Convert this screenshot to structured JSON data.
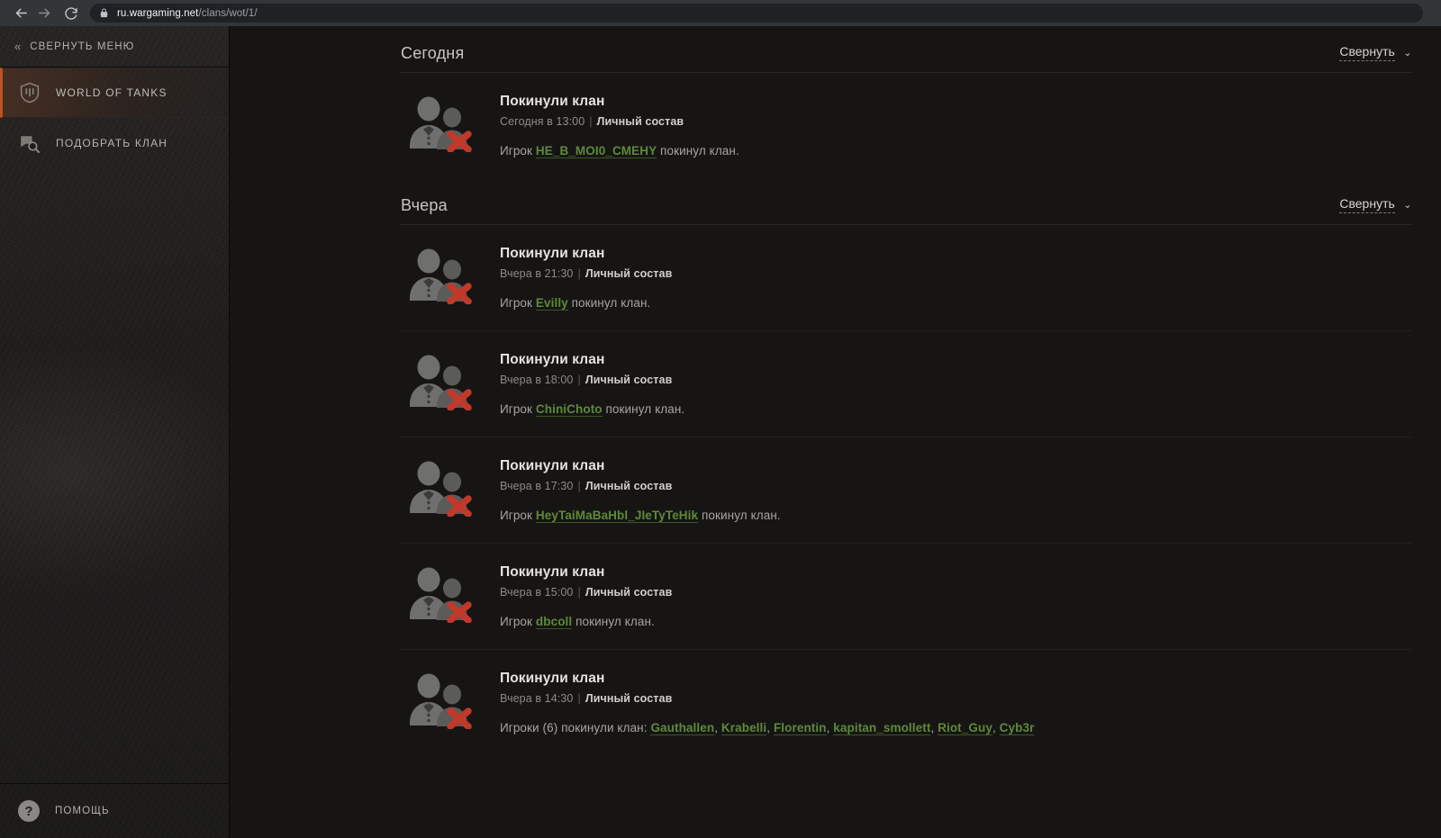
{
  "browser": {
    "back_icon": "back-arrow-icon",
    "forward_icon": "forward-arrow-icon",
    "reload_icon": "reload-icon",
    "lock_icon": "lock-icon",
    "url_host": "ru.wargaming.net",
    "url_path": "/clans/wot/1/"
  },
  "sidebar": {
    "collapse_label": "СВЕРНУТЬ МЕНЮ",
    "collapse_chevrons": "«",
    "items": [
      {
        "label": "WORLD OF TANKS",
        "icon": "wot-shield-icon",
        "active": true
      },
      {
        "label": "ПОДОБРАТЬ КЛАН",
        "icon": "clan-search-icon",
        "active": false
      }
    ],
    "footer": {
      "label": "ПОМОЩЬ",
      "icon": "help-question-icon",
      "glyph": "?"
    }
  },
  "colors": {
    "accent_orange": "#c2521c",
    "player_green": "#5e8a38",
    "red_cross": "#c0392b",
    "page_bg": "#161514",
    "sidebar_bg": "#1e1c1b"
  },
  "sections": [
    {
      "title": "Сегодня",
      "collapse_label": "Свернуть",
      "collapse_chevron": "⌄",
      "events": [
        {
          "icon": "clan-leave-icon",
          "title": "Покинули клан",
          "time": "Сегодня в 13:00",
          "separator": "|",
          "category": "Личный состав",
          "text_before": "Игрок ",
          "players": [
            "HE_B_MOI0_CMEHY"
          ],
          "text_after": " покинул клан."
        }
      ]
    },
    {
      "title": "Вчера",
      "collapse_label": "Свернуть",
      "collapse_chevron": "⌄",
      "events": [
        {
          "icon": "clan-leave-icon",
          "title": "Покинули клан",
          "time": "Вчера в 21:30",
          "separator": "|",
          "category": "Личный состав",
          "text_before": "Игрок ",
          "players": [
            "Evilly"
          ],
          "text_after": " покинул клан."
        },
        {
          "icon": "clan-leave-icon",
          "title": "Покинули клан",
          "time": "Вчера в 18:00",
          "separator": "|",
          "category": "Личный состав",
          "text_before": "Игрок ",
          "players": [
            "ChiniChoto"
          ],
          "text_after": " покинул клан."
        },
        {
          "icon": "clan-leave-icon",
          "title": "Покинули клан",
          "time": "Вчера в 17:30",
          "separator": "|",
          "category": "Личный состав",
          "text_before": "Игрок ",
          "players": [
            "HeyTaiMaBaHbl_JIeTyTeHik"
          ],
          "text_after": " покинул клан."
        },
        {
          "icon": "clan-leave-icon",
          "title": "Покинули клан",
          "time": "Вчера в 15:00",
          "separator": "|",
          "category": "Личный состав",
          "text_before": "Игрок ",
          "players": [
            "dbcoll"
          ],
          "text_after": " покинул клан."
        },
        {
          "icon": "clan-leave-icon",
          "title": "Покинули клан",
          "time": "Вчера в 14:30",
          "separator": "|",
          "category": "Личный состав",
          "text_before": "Игроки (6) покинули клан: ",
          "players": [
            "Gauthallen",
            "Krabelli",
            "Florentin",
            "kapitan_smollett",
            "Riot_Guy",
            "Cyb3r"
          ],
          "text_after": ""
        }
      ]
    }
  ]
}
